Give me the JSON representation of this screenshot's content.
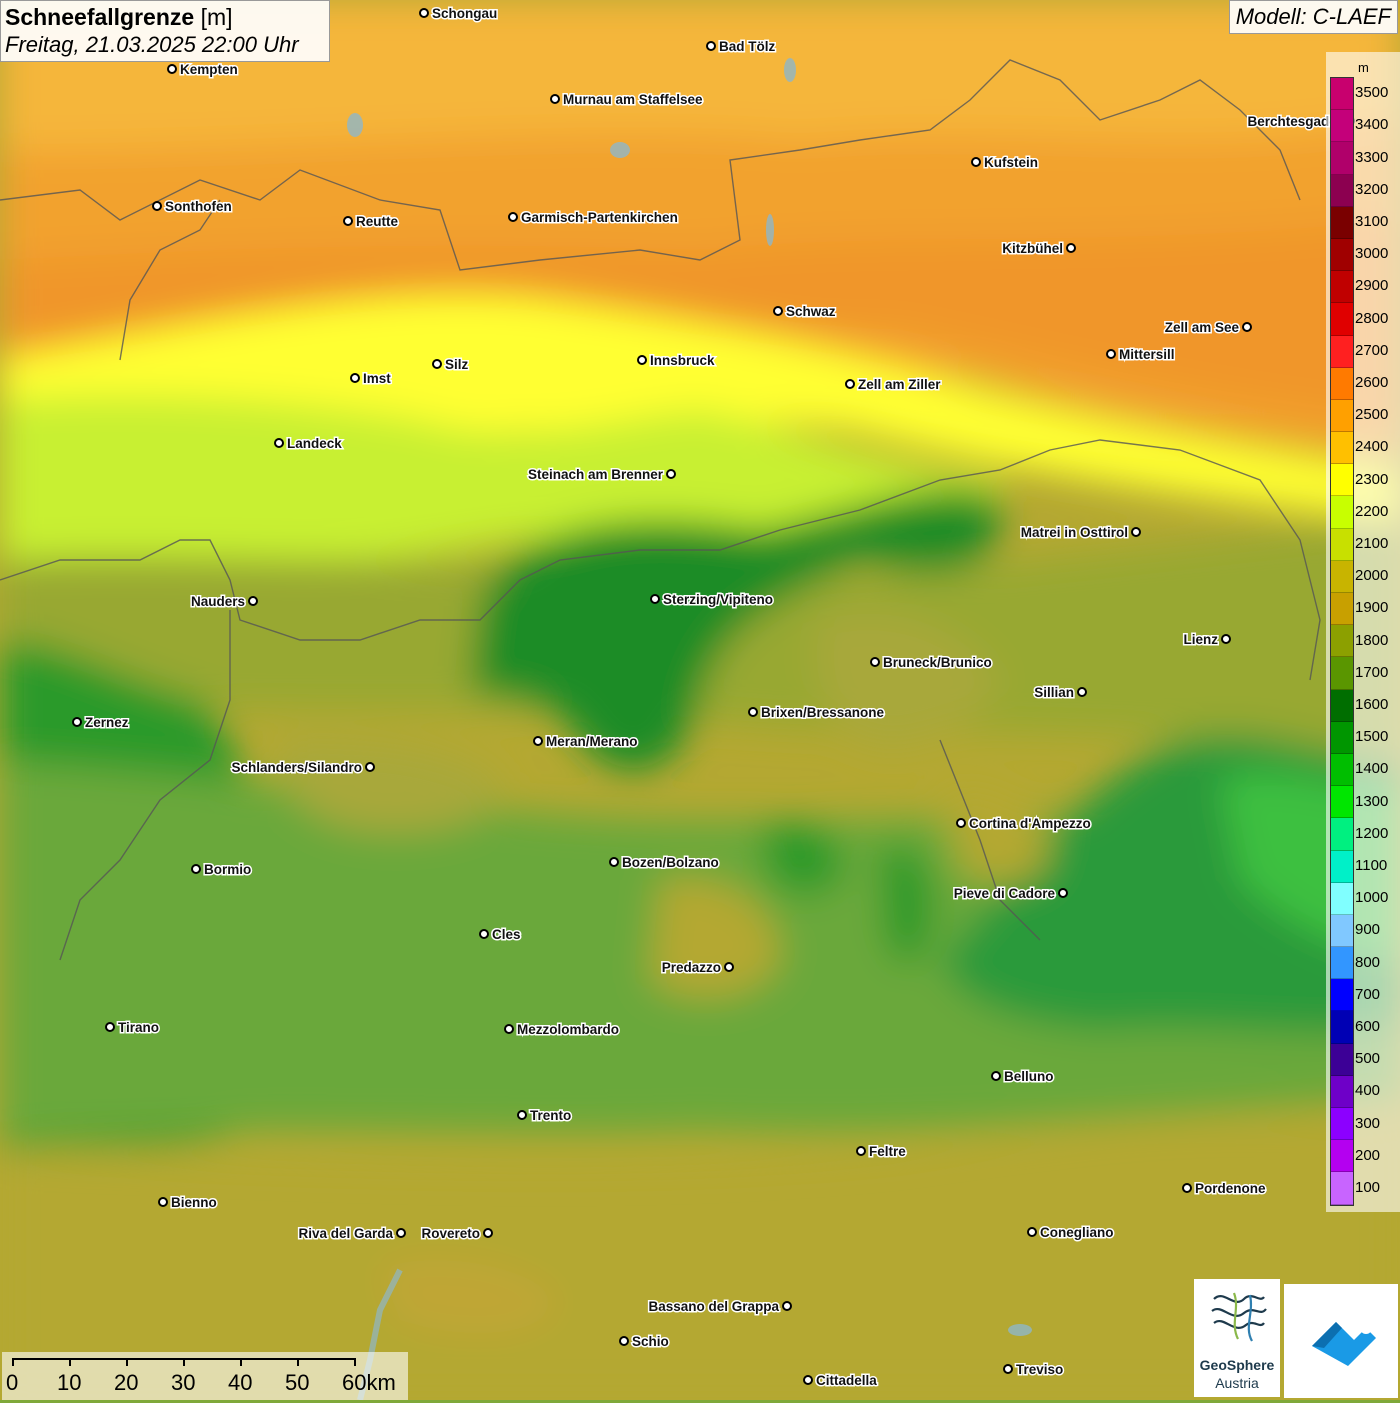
{
  "title": {
    "variable": "Schneefallgrenze",
    "unit": "[m]",
    "datetime": "Freitag, 21.03.2025 22:00 Uhr"
  },
  "model_label": "Modell: C-LAEF",
  "legend": {
    "unit": "m",
    "levels": [
      {
        "label": "3500",
        "color": "#c8006e"
      },
      {
        "label": "3400",
        "color": "#c4007a"
      },
      {
        "label": "3300",
        "color": "#b0006a"
      },
      {
        "label": "3200",
        "color": "#8c0050"
      },
      {
        "label": "3100",
        "color": "#7a0000"
      },
      {
        "label": "3000",
        "color": "#a00000"
      },
      {
        "label": "2900",
        "color": "#c00000"
      },
      {
        "label": "2800",
        "color": "#e00000"
      },
      {
        "label": "2700",
        "color": "#ff2020"
      },
      {
        "label": "2600",
        "color": "#ff7a00"
      },
      {
        "label": "2500",
        "color": "#ffa000"
      },
      {
        "label": "2400",
        "color": "#ffc000"
      },
      {
        "label": "2300",
        "color": "#ffff00"
      },
      {
        "label": "2200",
        "color": "#c8ff00"
      },
      {
        "label": "2100",
        "color": "#c8e000"
      },
      {
        "label": "2000",
        "color": "#c8b400"
      },
      {
        "label": "1900",
        "color": "#c8a000"
      },
      {
        "label": "1800",
        "color": "#8ca000"
      },
      {
        "label": "1700",
        "color": "#5a9600"
      },
      {
        "label": "1600",
        "color": "#006e00"
      },
      {
        "label": "1500",
        "color": "#009600"
      },
      {
        "label": "1400",
        "color": "#00be00"
      },
      {
        "label": "1300",
        "color": "#00e600"
      },
      {
        "label": "1200",
        "color": "#00f080"
      },
      {
        "label": "1100",
        "color": "#00f0c8"
      },
      {
        "label": "1000",
        "color": "#80ffff"
      },
      {
        "label": "900",
        "color": "#80c8ff"
      },
      {
        "label": "800",
        "color": "#3296ff"
      },
      {
        "label": "700",
        "color": "#0000ff"
      },
      {
        "label": "600",
        "color": "#0000b4"
      },
      {
        "label": "500",
        "color": "#3c0096"
      },
      {
        "label": "400",
        "color": "#6e00c8"
      },
      {
        "label": "300",
        "color": "#8c00ff"
      },
      {
        "label": "200",
        "color": "#b400f0"
      },
      {
        "label": "100",
        "color": "#c864ff"
      }
    ]
  },
  "scalebar": {
    "labels": [
      "0",
      "10",
      "20",
      "30",
      "40",
      "50",
      "60km"
    ]
  },
  "cities": [
    {
      "name": "Schongau"
    },
    {
      "name": "Kempten"
    },
    {
      "name": "Bad Tölz"
    },
    {
      "name": "Murnau am Staffelsee"
    },
    {
      "name": "Kufstein"
    },
    {
      "name": "Berchtesgaden"
    },
    {
      "name": "Sonthofen"
    },
    {
      "name": "Reutte"
    },
    {
      "name": "Garmisch-Partenkirchen"
    },
    {
      "name": "Kitzbühel"
    },
    {
      "name": "Schwaz"
    },
    {
      "name": "Zell am See"
    },
    {
      "name": "Innsbruck"
    },
    {
      "name": "Mittersill"
    },
    {
      "name": "Silz"
    },
    {
      "name": "Imst"
    },
    {
      "name": "Zell am Ziller"
    },
    {
      "name": "Landeck"
    },
    {
      "name": "Steinach am Brenner"
    },
    {
      "name": "Matrei in Osttirol"
    },
    {
      "name": "Nauders"
    },
    {
      "name": "Sterzing/Vipiteno"
    },
    {
      "name": "Lienz"
    },
    {
      "name": "Bruneck/Brunico"
    },
    {
      "name": "Sillian"
    },
    {
      "name": "Zernez"
    },
    {
      "name": "Brixen/Bressanone"
    },
    {
      "name": "Meran/Merano"
    },
    {
      "name": "Schlanders/Silandro"
    },
    {
      "name": "Cortina d'Ampezzo"
    },
    {
      "name": "Bozen/Bolzano"
    },
    {
      "name": "Bormio"
    },
    {
      "name": "Pieve di Cadore"
    },
    {
      "name": "Cles"
    },
    {
      "name": "Predazzo"
    },
    {
      "name": "Tirano"
    },
    {
      "name": "Mezzolombardo"
    },
    {
      "name": "Belluno"
    },
    {
      "name": "Trento"
    },
    {
      "name": "Feltre"
    },
    {
      "name": "Pordenone"
    },
    {
      "name": "Bienno"
    },
    {
      "name": "Riva del Garda"
    },
    {
      "name": "Rovereto"
    },
    {
      "name": "Conegliano"
    },
    {
      "name": "Bassano del Grappa"
    },
    {
      "name": "Schio"
    },
    {
      "name": "Treviso"
    },
    {
      "name": "Cittadella"
    }
  ],
  "logos": {
    "geosphere_line1": "GeoSphere",
    "geosphere_line2": "Austria"
  }
}
